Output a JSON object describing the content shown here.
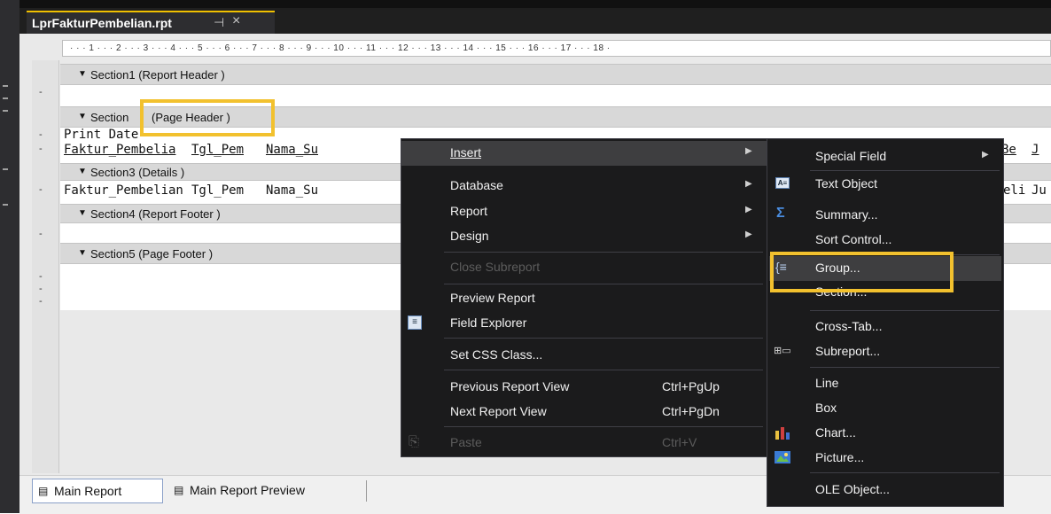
{
  "tab": {
    "title": "LprFakturPembelian.rpt",
    "pin": "⊣",
    "close": "×"
  },
  "ruler": {
    "text": "· · · 1 · · · 2 · · · 3 · · · 4 · · · 5 · · · 6 · · · 7 · · · 8 · · · 9 · · · 10 · · · 11 · · · 12 · · · 13 · · · 14 · · · 15 · · · 16 · · · 17 · · · 18 ·"
  },
  "sections": [
    {
      "label": "Section1 (Report Header )"
    },
    {
      "label": "Section",
      "label_highlight": "(Page Header )"
    },
    {
      "label": "Section3 (Details )"
    },
    {
      "label": "Section4 (Report Footer )"
    },
    {
      "label": "Section5 (Page Footer )"
    }
  ],
  "fields": {
    "print_date": "Print Date",
    "row1": {
      "faktur": "Faktur_Pembelia",
      "tgl": "Tgl_Pem",
      "nama": "Nama_Su",
      "right1": "Be",
      "right2": "J"
    },
    "row2": {
      "faktur": "Faktur_Pembelian",
      "tgl": "Tgl_Pem",
      "nama": "Nama_Su",
      "right1": "eli",
      "right2": "Ju"
    }
  },
  "context_menu": {
    "items": [
      {
        "label": "Insert",
        "has_submenu": true
      },
      {
        "label": "Database",
        "has_submenu": true
      },
      {
        "label": "Report",
        "has_submenu": true
      },
      {
        "label": "Design",
        "has_submenu": true
      },
      {
        "label": "Close Subreport",
        "disabled": true
      },
      {
        "label": "Preview Report"
      },
      {
        "label": "Field Explorer",
        "icon": "field-explorer-icon"
      },
      {
        "label": "Set CSS Class..."
      },
      {
        "label": "Previous Report View",
        "shortcut": "Ctrl+PgUp"
      },
      {
        "label": "Next Report View",
        "shortcut": "Ctrl+PgDn"
      },
      {
        "label": "Paste",
        "shortcut": "Ctrl+V",
        "disabled": true,
        "icon": "paste-icon"
      }
    ]
  },
  "insert_submenu": {
    "items": [
      {
        "label": "Special Field",
        "has_submenu": true
      },
      {
        "label": "Text Object",
        "icon": "text-object-icon"
      },
      {
        "label": "Summary...",
        "icon": "sigma-icon"
      },
      {
        "label": "Sort Control..."
      },
      {
        "label": "Group...",
        "icon": "group-icon"
      },
      {
        "label": "Section..."
      },
      {
        "label": "Cross-Tab..."
      },
      {
        "label": "Subreport...",
        "icon": "subreport-icon"
      },
      {
        "label": "Line"
      },
      {
        "label": "Box"
      },
      {
        "label": "Chart...",
        "icon": "chart-icon"
      },
      {
        "label": "Picture...",
        "icon": "picture-icon"
      },
      {
        "label": "OLE Object..."
      }
    ]
  },
  "bottom_tabs": [
    {
      "label": "Main Report",
      "active": true
    },
    {
      "label": "Main Report Preview"
    }
  ],
  "colors": {
    "highlight": "#f2c12e",
    "menu_bg": "#1b1b1c",
    "menu_hover": "#3e3e40"
  }
}
